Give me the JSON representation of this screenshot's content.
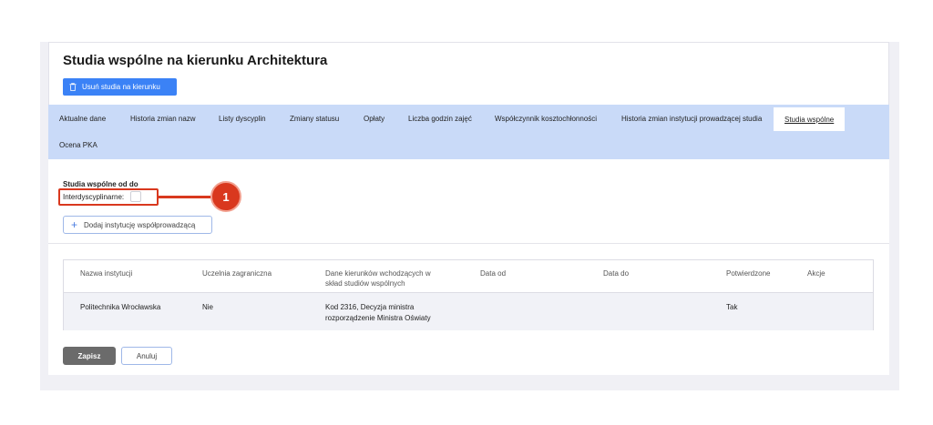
{
  "header": {
    "title": "Studia wspólne na kierunku Architektura",
    "delete_label": "Usuń studia na kierunku"
  },
  "tabs": [
    {
      "label": "Aktualne dane"
    },
    {
      "label": "Historia zmian nazw"
    },
    {
      "label": "Listy dyscyplin"
    },
    {
      "label": "Zmiany statusu"
    },
    {
      "label": "Opłaty"
    },
    {
      "label": "Liczba godzin zajęć"
    },
    {
      "label": "Współczynnik kosztochłonności"
    },
    {
      "label": "Historia zmian instytucji prowadzącej studia"
    },
    {
      "label": "Studia wspólne",
      "active": true
    },
    {
      "label": "Ocena PKA"
    }
  ],
  "form": {
    "section_label": "Studia wspólne od do",
    "interdisciplinary_label": "Interdyscyplinarne:",
    "callout_number": "1",
    "add_institution_label": "Dodaj instytucję współprowadzącą"
  },
  "table": {
    "headers": [
      "Nazwa instytucji",
      "Uczelnia zagraniczna",
      "Dane kierunków wchodzących w",
      "skład studiów wspólnych",
      "Data od",
      "Data do",
      "Potwierdzone",
      "Akcje"
    ],
    "rows": [
      {
        "institution": "Politechnika Wrocławska",
        "foreign": "Nie",
        "programs_line1": "Kod 2316, Decyzja ministra",
        "programs_line2": "rozporządzenie Ministra Oświaty",
        "date_from": "",
        "date_to": "",
        "confirmed": "Tak",
        "actions": ""
      }
    ]
  },
  "footer": {
    "save_label": "Zapisz",
    "cancel_label": "Anuluj"
  },
  "colors": {
    "accent": "#3b82f6",
    "tabbar": "#c9daf8",
    "highlight": "#d9381e"
  }
}
